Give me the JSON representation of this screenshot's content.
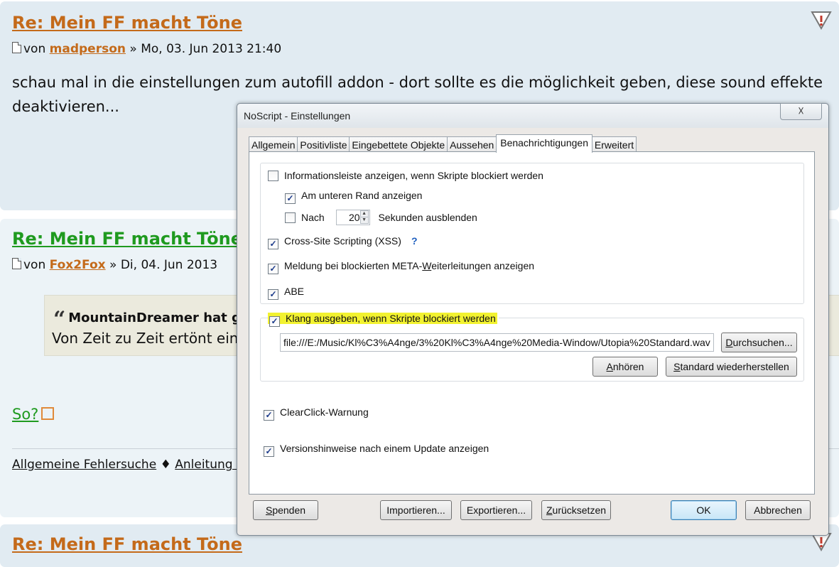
{
  "forum": {
    "posts": [
      {
        "title": "Re: Mein FF macht Töne",
        "meta_prefix": "von",
        "author": "madperson",
        "meta_suffix": "» Mo, 03. Jun 2013 21:40",
        "body_line1": "schau mal in die einstellungen zum autofill addon - dort sollte es die möglichkeit geben, diese sound effekte",
        "body_line2": "deaktivieren..."
      },
      {
        "title": "Re: Mein FF macht Töne",
        "meta_prefix": "von",
        "author": "Fox2Fox",
        "meta_suffix": "» Di, 04. Jun 2013",
        "quote_author": "MountainDreamer hat g",
        "quote_text": "Von Zeit zu Zeit ertönt ein",
        "link": "So?",
        "footer_link1": "Allgemeine Fehlersuche",
        "footer_sep": "♦",
        "footer_link2": "Anleitung fü"
      },
      {
        "title": "Re: Mein FF macht Töne"
      }
    ]
  },
  "dialog": {
    "title": "NoScript - Einstellungen",
    "close_glyph": "☓",
    "tabs": [
      {
        "label": "Allgemein",
        "active": false
      },
      {
        "label": "Positivliste",
        "active": false
      },
      {
        "label": "Eingebettete Objekte",
        "active": false
      },
      {
        "label": "Aussehen",
        "active": false
      },
      {
        "label": "Benachrichtigungen",
        "active": true
      },
      {
        "label": "Erweitert",
        "active": false
      }
    ],
    "options": {
      "infobar": {
        "label": "Informationsleiste anzeigen, wenn Skripte blockiert werden",
        "checked": false
      },
      "bottom": {
        "label": "Am unteren Rand anzeigen",
        "checked": true
      },
      "after_prefix": {
        "label": "Nach",
        "checked": false
      },
      "after_value": "20",
      "after_suffix": "Sekunden ausblenden",
      "xss": {
        "label": "Cross-Site Scripting (XSS)",
        "checked": true
      },
      "xss_help": "?",
      "meta_redirect": {
        "label_before": "Meldung bei blockierten META-",
        "label_u": "W",
        "label_after": "eiterleitungen anzeigen",
        "checked": true
      },
      "abe": {
        "label": "ABE",
        "checked": true
      },
      "sound": {
        "label": "Klang ausgeben, wenn Skripte blockiert werden",
        "checked": true
      },
      "sound_path": "file:///E:/Music/Kl%C3%A4nge/3%20Kl%C3%A4nge%20Media-Window/Utopia%20Standard.wav",
      "clearclick": {
        "label": "ClearClick-Warnung",
        "checked": true
      },
      "version_notes": {
        "label": "Versionshinweise nach einem Update anzeigen",
        "checked": true
      }
    },
    "buttons": {
      "browse_u": "D",
      "browse_rest": "urchsuchen...",
      "listen_u": "A",
      "listen_rest": "nhören",
      "restore_u": "S",
      "restore_rest": "tandard wiederherstellen",
      "donate_u": "S",
      "donate_rest": "penden",
      "import": "Importieren...",
      "export": "Exportieren...",
      "reset_u": "Z",
      "reset_rest": "urücksetzen",
      "ok": "OK",
      "cancel": "Abbrechen"
    },
    "colors": {
      "highlight": "#f2f230",
      "link_orange": "#c46a1a",
      "link_green": "#1f9a1f"
    }
  }
}
